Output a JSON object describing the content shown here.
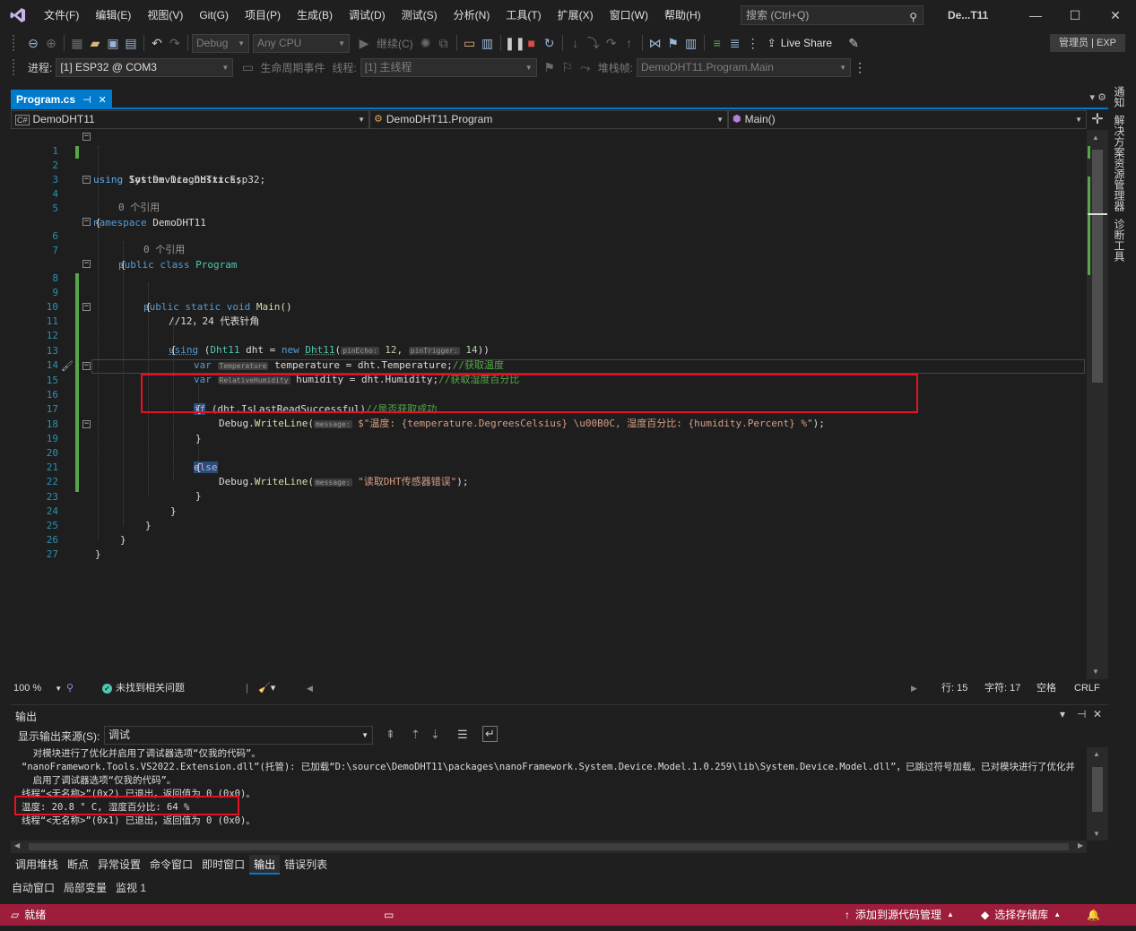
{
  "menu": {
    "items": [
      "文件(F)",
      "编辑(E)",
      "视图(V)",
      "Git(G)",
      "项目(P)",
      "生成(B)",
      "调试(D)",
      "测试(S)",
      "分析(N)",
      "工具(T)",
      "扩展(X)",
      "窗口(W)",
      "帮助(H)"
    ],
    "search_placeholder": "搜索 (Ctrl+Q)",
    "solution_title": "De...T11"
  },
  "toolbar1": {
    "config": "Debug",
    "platform": "Any CPU",
    "continue_label": "继续(C)",
    "live_share": "Live Share",
    "admin_badge": "管理员 | EXP"
  },
  "toolbar2": {
    "process_label": "进程:",
    "process_value": "[1] ESP32 @ COM3",
    "lifecycle_label": "生命周期事件",
    "thread_label": "线程:",
    "thread_value": "[1] 主线程",
    "stackframe_label": "堆栈帧:",
    "stackframe_value": "DemoDHT11.Program.Main"
  },
  "editor_tab": {
    "label": "Program.cs",
    "pin": "⊣",
    "close": "✕"
  },
  "navbar": {
    "project": "DemoDHT11",
    "class": "DemoDHT11.Program",
    "member": "Main()"
  },
  "right_rail": [
    "通知",
    "解决方案资源管理器",
    "诊断工具"
  ],
  "code": {
    "codelens": [
      "0 个引用",
      "0 个引用"
    ],
    "line_numbers": [
      "1",
      "2",
      "3",
      "4",
      "5",
      "6",
      "7",
      "8",
      "9",
      "10",
      "11",
      "12",
      "13",
      "14",
      "15",
      "16",
      "17",
      "18",
      "19",
      "20",
      "21",
      "22",
      "23",
      "24",
      "25",
      "26",
      "27"
    ],
    "l1_kw": "using",
    "l1_ns": " Iot.Device.DHTxx.Esp32;",
    "l2_kw": "using",
    "l2_ns": " System.Diagnostics;",
    "l4_kw": "namespace",
    "l4_name": " DemoDHT11",
    "brace_open": "{",
    "brace_close": "}",
    "l6_kw": "public class",
    "l6_name": "Program",
    "l8_kw": "public static void",
    "l8_name": "Main",
    "l8_parens": "()",
    "l10_comment": "//12，24 代表针角",
    "l11_using": "using",
    "l11_open": " (",
    "l11_type": "Dht11",
    "l11_mid": " dht = ",
    "l11_new": "new",
    "l11_ctor": "Dht11",
    "l11_paren": "(",
    "l11_hint1": "pinEcho:",
    "l11_num1": "12",
    "l11_comma": ", ",
    "l11_hint2": "pinTrigger:",
    "l11_num2": "14",
    "l11_end": "))",
    "l13_var": "var",
    "l13_hint": "Temperature",
    "l13_rest": " temperature = dht.Temperature;",
    "l13_comment": "//获取温度",
    "l14_var": "var",
    "l14_hint": "RelativeHumidity",
    "l14_rest": " humidity = dht.Humidity;",
    "l14_comment": "//获取湿度百分比",
    "l15_if": "if",
    "l15_rest": " (dht.IsLastReadSuccessful)",
    "l15_comment": "//是否获取成功",
    "l17_debug": "Debug.",
    "l17_method": "WriteLine",
    "l17_paren": "(",
    "l17_hint": "message:",
    "l17_str": " $\"温度: {temperature.DegreesCelsius} \\u00B0C, 湿度百分比: {humidity.Percent} %\"",
    "l17_end": ");",
    "l19_else": "else",
    "l21_debug": "Debug.",
    "l21_method": "WriteLine",
    "l21_paren": "(",
    "l21_hint": "message:",
    "l21_str": " \"读取DHT传感器错误\"",
    "l21_end": ");"
  },
  "editor_status": {
    "zoom": "100 %",
    "issues": "未找到相关问题",
    "line": "行: 15",
    "col": "字符: 17",
    "spaces": "空格",
    "eol": "CRLF"
  },
  "output": {
    "title": "输出",
    "source_label": "显示输出来源(S):",
    "source_value": "调试",
    "lines": [
      "  对模块进行了优化并启用了调试器选项“仅我的代码”。",
      "“nanoFramework.Tools.VS2022.Extension.dll”(托管): 已加载“D:\\source\\DemoDHT11\\packages\\nanoFramework.System.Device.Model.1.0.259\\lib\\System.Device.Model.dll”，已跳过符号加载。已对模块进行了优化并",
      "  启用了调试器选项“仅我的代码”。",
      "线程“<无名称>”(0x2) 已退出，返回值为 0 (0x0)。",
      "温度: 20.8 ° C, 湿度百分比: 64 %",
      "线程“<无名称>”(0x1) 已退出，返回值为 0 (0x0)。"
    ]
  },
  "tool_tabs_row1": [
    "调用堆栈",
    "断点",
    "异常设置",
    "命令窗口",
    "即时窗口",
    "输出",
    "错误列表"
  ],
  "tool_tabs_row2": [
    "自动窗口",
    "局部变量",
    "监视 1"
  ],
  "statusbar": {
    "ready": "就绪",
    "source_control": "添加到源代码管理",
    "repo": "选择存储库"
  },
  "colors": {
    "accent": "#007acc",
    "statusbar": "#9d1d3a",
    "highlight_box": "#e81123",
    "change_bar": "#57a64a"
  }
}
